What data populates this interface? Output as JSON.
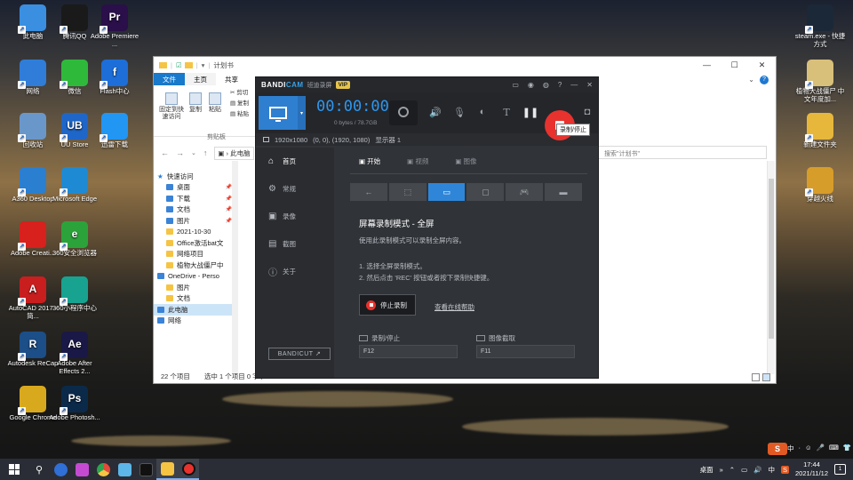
{
  "desktop": {
    "left_icons": [
      {
        "label": "此电脑",
        "color": "#3a8fe0"
      },
      {
        "label": "腾讯QQ",
        "color": "#1a1a1a"
      },
      {
        "label": "Adobe Premiere ...",
        "color": "#2a0f4a",
        "glyph": "Pr"
      },
      {
        "label": "网络",
        "color": "#2f7dd8"
      },
      {
        "label": "微信",
        "color": "#2fb93b"
      },
      {
        "label": "Flash中心",
        "color": "#1d6ed8",
        "glyph": "f"
      },
      {
        "label": "回收站",
        "color": "#6a97c9"
      },
      {
        "label": "UU Store",
        "color": "#1f66c9",
        "glyph": "UB"
      },
      {
        "label": "迅雷下载",
        "color": "#2196f3"
      },
      {
        "label": "A360 Desktop",
        "color": "#2a7fd1"
      },
      {
        "label": "Microsoft Edge",
        "color": "#1f8ad4"
      },
      {
        "label": "Adobe Creati...",
        "color": "#d8201c"
      },
      {
        "label": "360安全浏览器",
        "color": "#2ba33a",
        "glyph": "e"
      },
      {
        "label": "AutoCAD 2017 - 简...",
        "color": "#c81e1e",
        "glyph": "A"
      },
      {
        "label": "360小程序中心",
        "color": "#17a390"
      },
      {
        "label": "Autodesk ReCap",
        "color": "#1c4e87",
        "glyph": "R"
      },
      {
        "label": "Adobe After Effects 2...",
        "color": "#1a1846",
        "glyph": "Ae"
      },
      {
        "label": "Google Chrome",
        "color": "#d9a91d"
      },
      {
        "label": "Adobe Photosh...",
        "color": "#0b2a4a",
        "glyph": "Ps"
      }
    ],
    "right_icons": [
      {
        "label": "steam.exe - 快捷方式",
        "color": "#1b2838"
      },
      {
        "label": "植物大战僵尸 中文年度加...",
        "color": "#d8c07a"
      },
      {
        "label": "新建文件夹",
        "color": "#e7b73c"
      },
      {
        "label": "穿越火线",
        "color": "#d79d2a"
      }
    ]
  },
  "explorer": {
    "title": "计划书",
    "tabs": [
      "文件",
      "主页",
      "共享"
    ],
    "ribbon": {
      "pin_label": "固定到快速访问",
      "copy_label": "复制",
      "paste_label": "粘贴",
      "cut_label": "剪切",
      "copypath_label": "复制",
      "paste_shortcut_label": "粘贴",
      "group_label": "剪贴板"
    },
    "address_partial": "此电脑",
    "search_placeholder": "搜索\"计划书\"",
    "sidebar": [
      {
        "label": "快速访问",
        "type": "star"
      },
      {
        "label": "桌面",
        "type": "blue",
        "pinned": true
      },
      {
        "label": "下载",
        "type": "blue",
        "pinned": true
      },
      {
        "label": "文档",
        "type": "blue",
        "pinned": true
      },
      {
        "label": "图片",
        "type": "blue",
        "pinned": true
      },
      {
        "label": "2021-10-30",
        "type": "folder"
      },
      {
        "label": "Office激活bat文",
        "type": "folder"
      },
      {
        "label": "网络项目",
        "type": "folder"
      },
      {
        "label": "植物大战僵尸中",
        "type": "folder"
      },
      {
        "label": "OneDrive - Perso",
        "type": "blue"
      },
      {
        "label": "图片",
        "type": "folder"
      },
      {
        "label": "文档",
        "type": "folder"
      },
      {
        "label": "此电脑",
        "type": "blue",
        "selected": true
      },
      {
        "label": "网络",
        "type": "blue"
      }
    ],
    "status": {
      "count": "22 个项目",
      "selected": "选中 1 个项目 0 字节"
    }
  },
  "bandicam": {
    "logo_a": "BANDI",
    "logo_b": "CAM",
    "registration": "班迪录屏",
    "vip": "VIP",
    "timer": "00:00:00",
    "size_info": "0 bytes / 78.7GB",
    "tooltip": "录制/停止",
    "region": {
      "resolution": "1920x1080",
      "coords": "(0, 0), (1920, 1080)",
      "display": "显示器 1"
    },
    "nav": [
      {
        "label": "首页",
        "icon": "home-icon",
        "glyph": "⌂",
        "active": true
      },
      {
        "label": "常规",
        "icon": "gear-icon",
        "glyph": "⚙",
        "active": false
      },
      {
        "label": "录像",
        "icon": "video-icon",
        "glyph": "▣",
        "active": false
      },
      {
        "label": "截图",
        "icon": "image-icon",
        "glyph": "▤",
        "active": false
      },
      {
        "label": "关于",
        "icon": "info-icon",
        "glyph": "ⓘ",
        "active": false
      }
    ],
    "bandicut": "BANDICUT ↗",
    "subtabs": [
      {
        "label": "开始",
        "active": true
      },
      {
        "label": "视频",
        "active": false
      },
      {
        "label": "图像",
        "active": false
      }
    ],
    "modes": [
      "←",
      "⬚",
      "▭",
      "▢",
      "🎮",
      "▬"
    ],
    "heading": "屏幕录制模式 - 全屏",
    "description": "使用此录制模式可以录制全屏内容。",
    "step1": "1. 选择全屏录制模式。",
    "step2": "2. 然后点击 'REC' 按钮或者按下录制快捷键。",
    "stop_label": "停止录制",
    "help_link": "查看在线帮助",
    "hotkey_record_label": "录制/停止",
    "hotkey_record_value": "F12",
    "hotkey_capture_label": "图像截取",
    "hotkey_capture_value": "F11"
  },
  "taskbar": {
    "tray_desktop": "桌面",
    "ime": "中",
    "time": "17:44",
    "date": "2021/11/12",
    "notif": "1"
  },
  "ime_bar": [
    "中",
    "·",
    "☺",
    "🎤",
    "⌨",
    "👕",
    "⋮⋮"
  ]
}
